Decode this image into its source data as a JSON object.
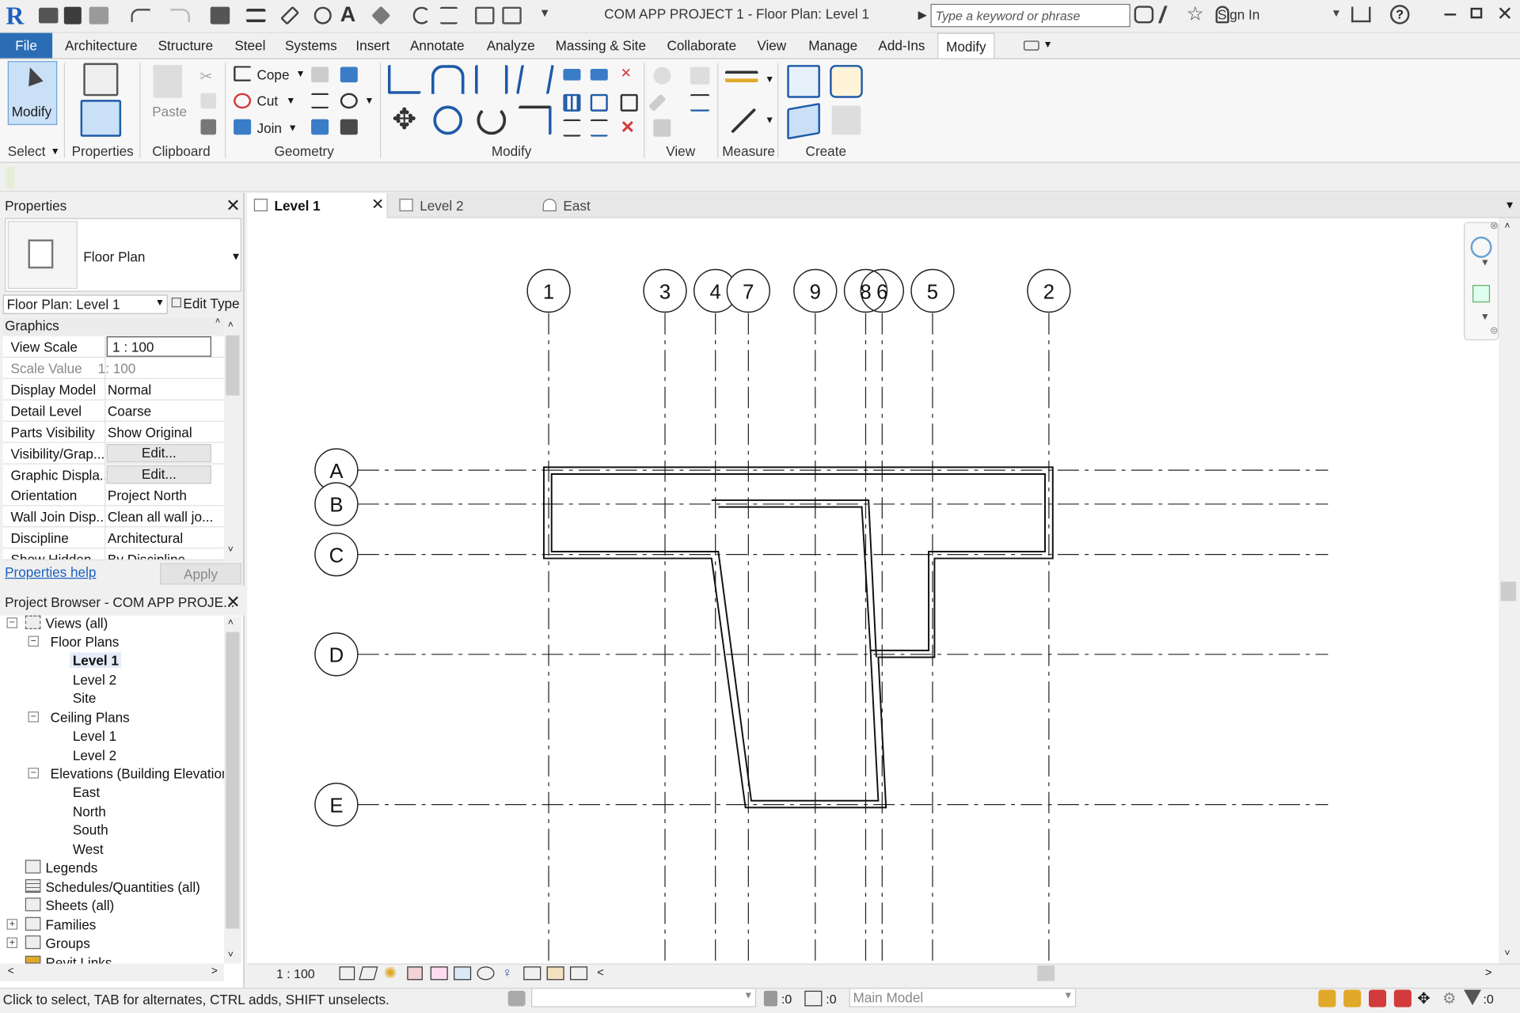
{
  "window": {
    "title": "COM APP PROJECT 1 - Floor Plan: Level 1",
    "search_placeholder": "Type a keyword or phrase",
    "sign_in": "Sign In"
  },
  "ribbon_tabs": [
    "File",
    "Architecture",
    "Structure",
    "Steel",
    "Systems",
    "Insert",
    "Annotate",
    "Analyze",
    "Massing & Site",
    "Collaborate",
    "View",
    "Manage",
    "Add-Ins",
    "Modify"
  ],
  "active_tab": "Modify",
  "ribbon": {
    "modify_label": "Modify",
    "paste_label": "Paste",
    "cope_label": "Cope",
    "cut_label": "Cut",
    "join_label": "Join",
    "panels": [
      "Select",
      "Properties",
      "Clipboard",
      "Geometry",
      "Modify",
      "View",
      "Measure",
      "Create"
    ]
  },
  "properties": {
    "title": "Properties",
    "type_name": "Floor Plan",
    "instance_selector": "Floor Plan: Level 1",
    "edit_type": "Edit Type",
    "group": "Graphics",
    "rows": [
      {
        "key": "View Scale",
        "value": "1 : 100"
      },
      {
        "key": "Scale Value",
        "value": "1:  100"
      },
      {
        "key": "Display Model",
        "value": "Normal"
      },
      {
        "key": "Detail Level",
        "value": "Coarse"
      },
      {
        "key": "Parts Visibility",
        "value": "Show Original"
      },
      {
        "key": "Visibility/Grap...",
        "value": "Edit..."
      },
      {
        "key": "Graphic Displa...",
        "value": "Edit..."
      },
      {
        "key": "Orientation",
        "value": "Project North"
      },
      {
        "key": "Wall Join Disp...",
        "value": "Clean all wall jo..."
      },
      {
        "key": "Discipline",
        "value": "Architectural"
      },
      {
        "key": "Show Hidden",
        "value": "By Discipline"
      }
    ],
    "help_link": "Properties help",
    "apply": "Apply"
  },
  "project_browser": {
    "title": "Project Browser - COM APP PROJE...",
    "nodes": {
      "views": "Views (all)",
      "floor_plans": "Floor Plans",
      "fp_level1": "Level 1",
      "fp_level2": "Level 2",
      "fp_site": "Site",
      "ceiling_plans": "Ceiling Plans",
      "cp_level1": "Level 1",
      "cp_level2": "Level 2",
      "elevations": "Elevations (Building Elevation",
      "east": "East",
      "north": "North",
      "south": "South",
      "west": "West",
      "legends": "Legends",
      "schedules": "Schedules/Quantities (all)",
      "sheets": "Sheets (all)",
      "families": "Families",
      "groups": "Groups",
      "revit_links": "Revit Links"
    }
  },
  "view_tabs": [
    "Level 1",
    "Level 2",
    "East"
  ],
  "grids": {
    "vertical": [
      "1",
      "3",
      "4",
      "7",
      "9",
      "8",
      "6",
      "5",
      "2"
    ],
    "horizontal": [
      "A",
      "B",
      "C",
      "D",
      "E"
    ]
  },
  "view_control": {
    "scale": "1 : 100"
  },
  "status": {
    "message": "Click to select, TAB for alternates, CTRL adds, SHIFT unselects.",
    "model": "Main Model",
    "count1": ":0",
    "count2": ":0"
  }
}
